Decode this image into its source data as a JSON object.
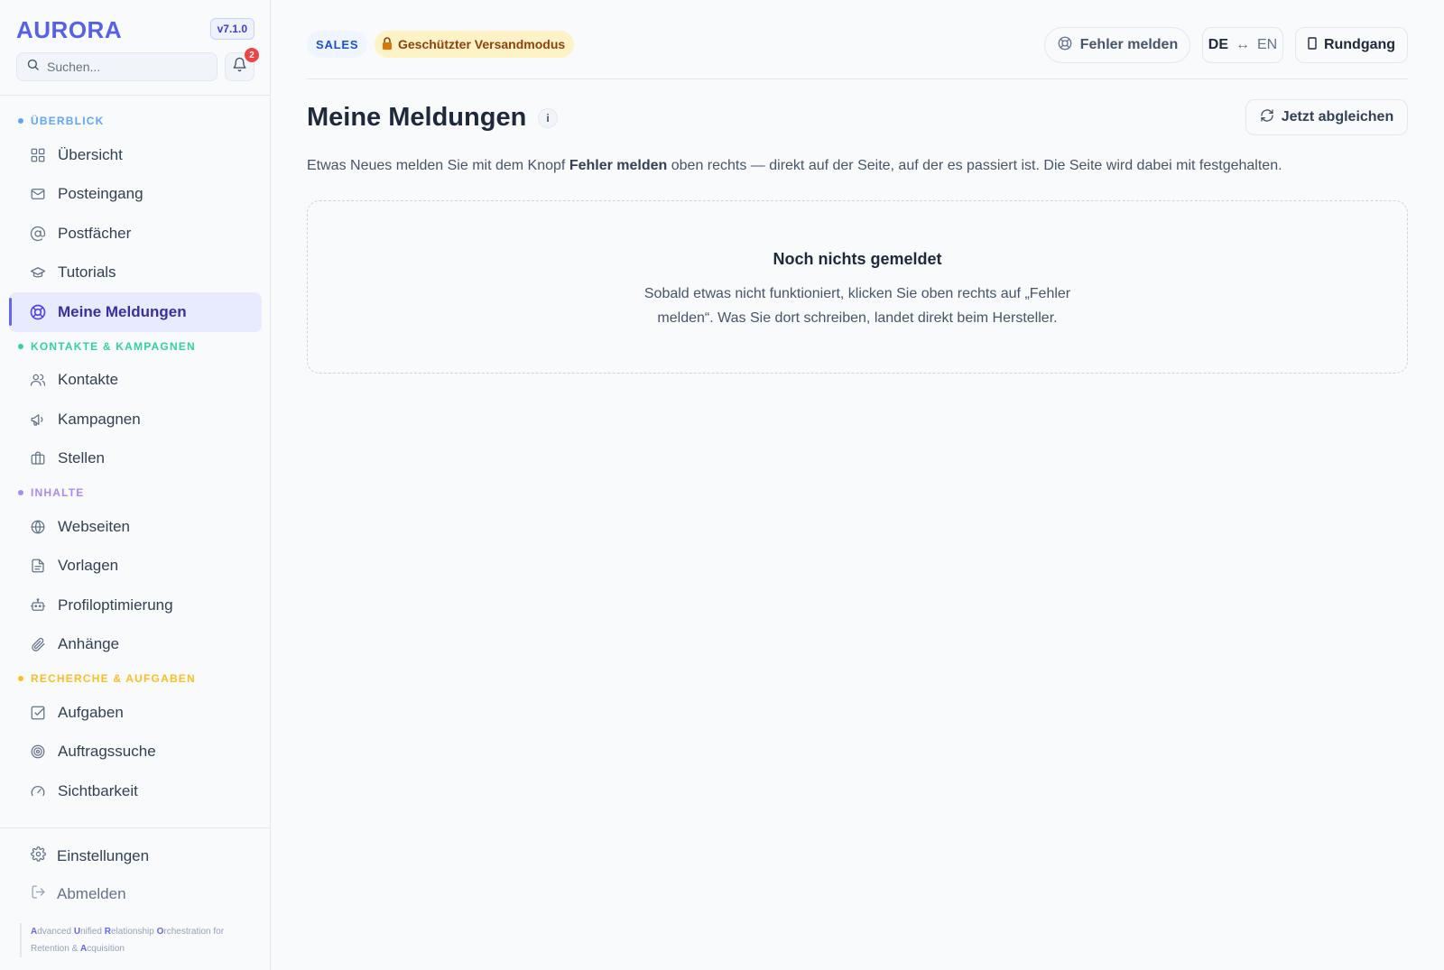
{
  "sidebar": {
    "brand": "AURORA",
    "version": "v7.1.0",
    "search_placeholder": "Suchen...",
    "notifications_count": "2",
    "sections": [
      {
        "title": "ÜBERBLICK",
        "color": "#60a5fa",
        "items": [
          {
            "label": "Übersicht",
            "icon": "grid-icon"
          },
          {
            "label": "Posteingang",
            "icon": "mail-icon"
          },
          {
            "label": "Postfächer",
            "icon": "at-icon"
          },
          {
            "label": "Tutorials",
            "icon": "graduation-cap-icon"
          },
          {
            "label": "Meine Meldungen",
            "icon": "lifebuoy-icon",
            "active": true
          }
        ]
      },
      {
        "title": "KONTAKTE & KAMPAGNEN",
        "color": "#34d399",
        "items": [
          {
            "label": "Kontakte",
            "icon": "users-icon"
          },
          {
            "label": "Kampagnen",
            "icon": "megaphone-icon"
          },
          {
            "label": "Stellen",
            "icon": "briefcase-icon"
          }
        ]
      },
      {
        "title": "INHALTE",
        "color": "#a78bfa",
        "items": [
          {
            "label": "Webseiten",
            "icon": "globe-icon"
          },
          {
            "label": "Vorlagen",
            "icon": "document-icon"
          },
          {
            "label": "Profiloptimierung",
            "icon": "robot-icon"
          },
          {
            "label": "Anhänge",
            "icon": "paperclip-icon"
          }
        ]
      },
      {
        "title": "RECHERCHE & AUFGABEN",
        "color": "#fbbf24",
        "items": [
          {
            "label": "Aufgaben",
            "icon": "checkbox-icon"
          },
          {
            "label": "Auftragssuche",
            "icon": "target-icon"
          },
          {
            "label": "Sichtbarkeit",
            "icon": "gauge-icon"
          }
        ]
      }
    ],
    "bottom": {
      "settings": "Einstellungen",
      "logout": "Abmelden"
    },
    "acronym_parts": [
      [
        "A",
        "dvanced "
      ],
      [
        "U",
        "nified "
      ],
      [
        "R",
        "elationship "
      ],
      [
        "O",
        "rchestration for Retention & "
      ],
      [
        "A",
        "cquisition"
      ]
    ]
  },
  "topbar": {
    "chip_sales": "SALES",
    "chip_mode": "Geschützter Versandmodus",
    "report_button": "Fehler melden",
    "lang_de": "DE",
    "lang_arrow": "↔",
    "lang_en": "EN",
    "tour_button": "Rundgang"
  },
  "main": {
    "title": "Meine Meldungen",
    "info": "i",
    "sync_button": "Jetzt abgleichen",
    "hint_before": "Etwas Neues melden Sie mit dem Knopf ",
    "hint_bold": "Fehler melden",
    "hint_after": " oben rechts — direkt auf der Seite, auf der es passiert ist. Die Seite wird dabei mit festgehalten.",
    "empty_title": "Noch nichts gemeldet",
    "empty_text": "Sobald etwas nicht funktioniert, klicken Sie oben rechts auf „Fehler melden“. Was Sie dort schreiben, landet direkt beim Hersteller."
  },
  "colors": {
    "accent": "#6366f1",
    "brand": "#5561e8",
    "warning_bg": "#fef3c7",
    "badge": "#ef4444"
  }
}
